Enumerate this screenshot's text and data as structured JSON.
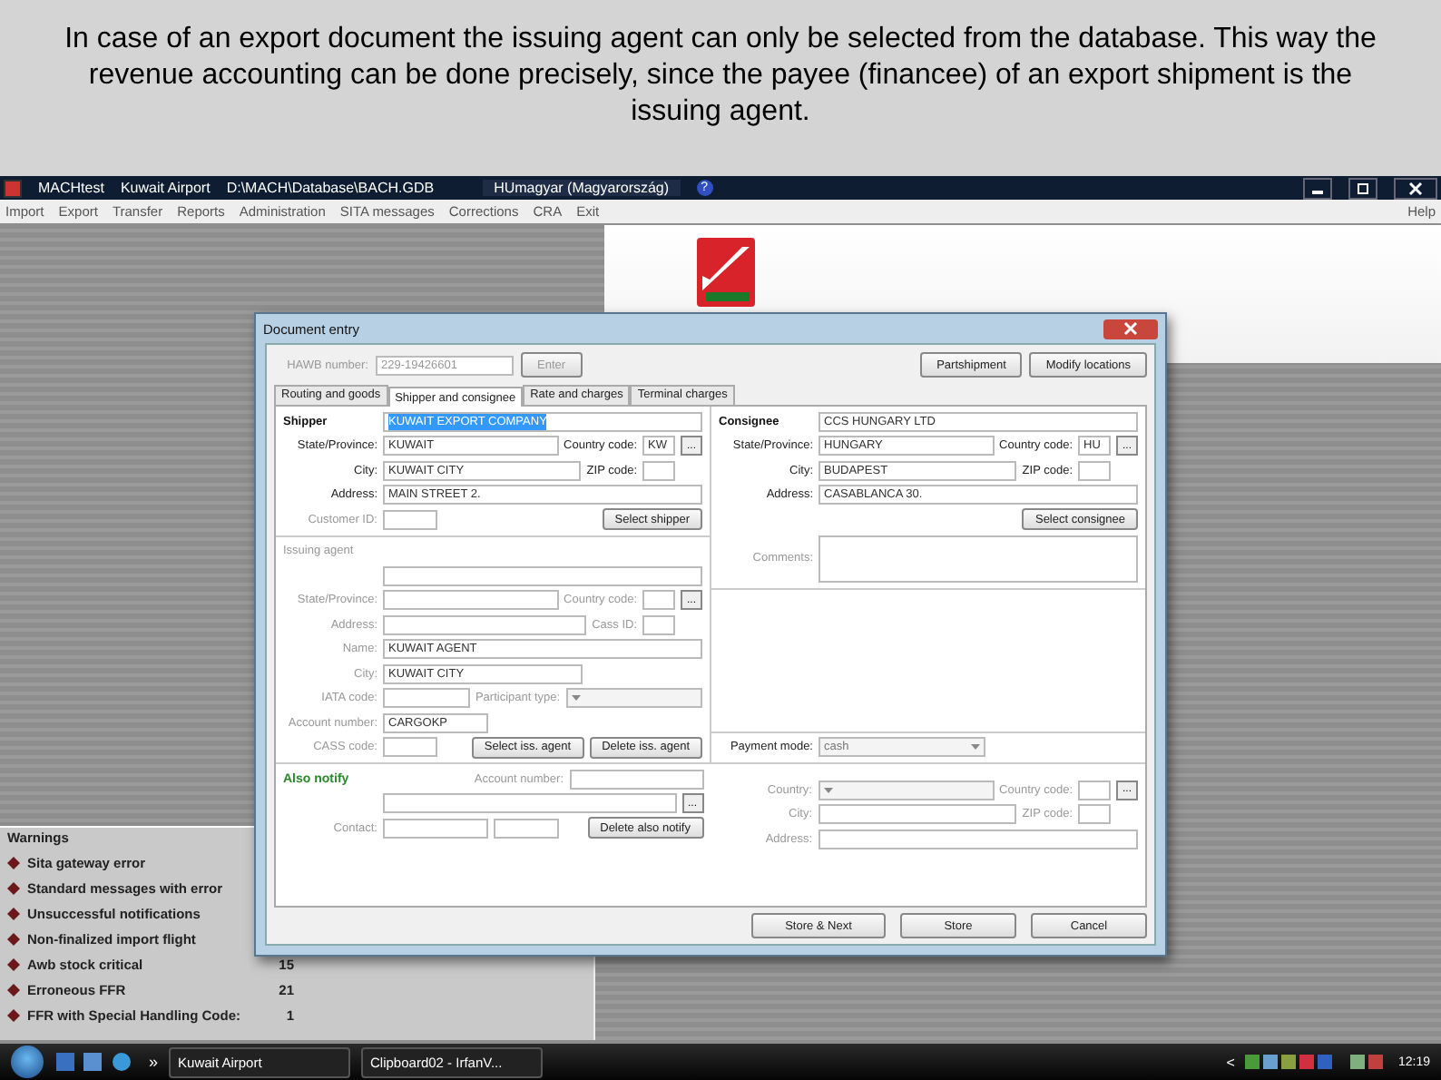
{
  "caption": "In case of an export document the issuing agent can only be selected from the database. This way the revenue accounting can be done precisely, since the payee (financee) of an export shipment is the issuing agent.",
  "app": {
    "title_parts": [
      "MACHtest",
      "Kuwait Airport",
      "D:\\MACH\\Database\\BACH.GDB"
    ],
    "language": "HUmagyar (Magyarország)",
    "help_icon": "?",
    "menu": [
      "Import",
      "Export",
      "Transfer",
      "Reports",
      "Administration",
      "SITA messages",
      "Corrections",
      "CRA",
      "Exit"
    ],
    "help": "Help"
  },
  "dialog": {
    "title": "Document entry",
    "hawb_label": "HAWB number:",
    "hawb_value": "229-19426601",
    "enter_button": "Enter",
    "top_buttons": [
      "Partshipment",
      "Modify locations"
    ],
    "tabs": [
      {
        "label": "Routing and goods",
        "selected": false
      },
      {
        "label": "Shipper and consignee",
        "selected": true
      },
      {
        "label": "Rate and charges",
        "selected": false
      },
      {
        "label": "Terminal charges",
        "selected": false
      }
    ],
    "left": [
      {
        "kind": "head",
        "label": "Shipper",
        "value": "KUWAIT EXPORT COMPANY",
        "highlighted": true,
        "disabled": false
      },
      {
        "kind": "pair",
        "label": "State/Province:",
        "value": "KUWAIT",
        "label2": "Country code:",
        "value2": "KW",
        "more": "...",
        "disabled": false
      },
      {
        "kind": "pair",
        "label": "City:",
        "value": "KUWAIT CITY",
        "label2": "ZIP code:",
        "disabled": false
      },
      {
        "kind": "wide",
        "label": "Address:",
        "value": "MAIN STREET 2.",
        "disabled": false
      },
      {
        "kind": "buttons",
        "label": "Customer ID:",
        "buttons": [
          "Select shipper"
        ],
        "disabled": true
      },
      {
        "kind": "rule"
      },
      {
        "kind": "title",
        "label": "Issuing agent",
        "disabled": true
      },
      {
        "kind": "wide"
      },
      {
        "kind": "pair",
        "label": "State/Province:",
        "label2": "Country code:",
        "more": "...",
        "disabled": true
      },
      {
        "kind": "pair",
        "label": "Address:",
        "label2": "Cass ID:",
        "disabled": true
      },
      {
        "kind": "wide",
        "label": "Name:",
        "value": "KUWAIT AGENT",
        "disabled": true
      },
      {
        "kind": "half",
        "label": "City:",
        "value": "KUWAIT CITY",
        "disabled": true
      },
      {
        "kind": "select",
        "label": "IATA code:",
        "label2": "Participant type:",
        "disabled": true
      },
      {
        "kind": "short",
        "label": "Account number:",
        "value": "CARGOKP",
        "disabled": true
      },
      {
        "kind": "buttons",
        "label": "CASS code:",
        "buttons": [
          "Select iss. agent",
          "Delete iss. agent"
        ],
        "disabled": true
      }
    ],
    "right": [
      {
        "kind": "head",
        "label": "Consignee",
        "value": "CCS HUNGARY LTD",
        "highlighted": false,
        "disabled": false
      },
      {
        "kind": "pair",
        "label": "State/Province:",
        "value": "HUNGARY",
        "label2": "Country code:",
        "value2": "HU",
        "more": "...",
        "disabled": false
      },
      {
        "kind": "pair",
        "label": "City:",
        "value": "BUDAPEST",
        "label2": "ZIP code:",
        "disabled": false
      },
      {
        "kind": "wide",
        "label": "Address:",
        "value": "CASABLANCA 30.",
        "disabled": false
      },
      {
        "kind": "buttons",
        "buttons": [
          "Select consignee"
        ]
      },
      {
        "kind": "area",
        "label": "Comments:",
        "disabled": true
      },
      {
        "kind": "rule"
      },
      {
        "kind": "space"
      },
      {
        "kind": "rule"
      },
      {
        "kind": "select",
        "label": "Payment mode:",
        "value": "cash",
        "disabled": false
      }
    ],
    "notify_title": "Also notify",
    "notify_left": [
      {
        "kind": "account",
        "label2": "Account number:",
        "disabled": true
      },
      {
        "kind": "wide",
        "more": "..."
      },
      {
        "kind": "contact",
        "label": "Contact:",
        "buttons": [
          "Delete also notify"
        ],
        "disabled": true
      }
    ],
    "notify_right": [
      {
        "kind": "pair_select",
        "label": "Country:",
        "label2": "Country code:",
        "more": "...",
        "disabled": true
      },
      {
        "kind": "pair",
        "label": "City:",
        "label2": "ZIP code:",
        "disabled": true
      },
      {
        "kind": "wide",
        "label": "Address:",
        "disabled": true
      }
    ],
    "bottom_buttons": [
      "Store & Next",
      "Store",
      "Cancel"
    ]
  },
  "warnings": {
    "title": "Warnings",
    "items": [
      {
        "label": "Sita gateway error"
      },
      {
        "label": "Standard messages with error"
      },
      {
        "label": "Unsuccessful notifications"
      },
      {
        "label": "Non-finalized import flight"
      },
      {
        "label": "Awb stock critical",
        "count": "15"
      },
      {
        "label": "Erroneous FFR",
        "count": "21"
      },
      {
        "label": "FFR with Special Handling Code:",
        "count": "1"
      }
    ]
  },
  "taskbar": {
    "more": "»",
    "tasks": [
      "Kuwait Airport",
      "Clipboard02 - IrfanV..."
    ],
    "tray_arrow": "<",
    "clock": "12:19"
  }
}
